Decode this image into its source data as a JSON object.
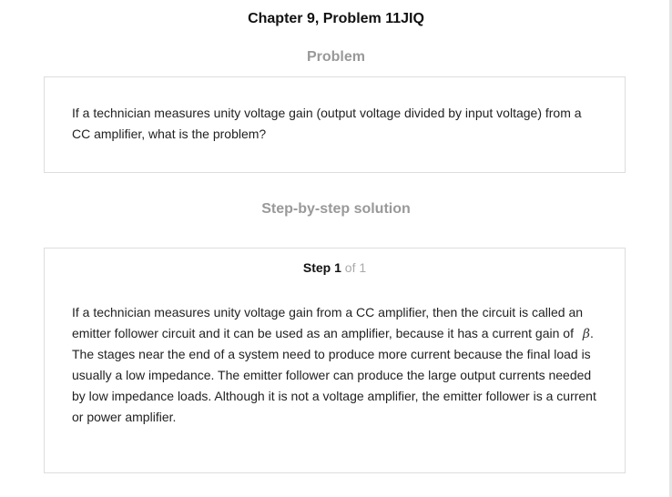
{
  "chapter_title": "Chapter 9, Problem 11JIQ",
  "problem": {
    "heading": "Problem",
    "text": "If a technician measures unity voltage gain (output voltage divided by input voltage) from a CC amplifier, what is the problem?"
  },
  "solution": {
    "heading": "Step-by-step solution",
    "step": {
      "word": "Step",
      "number": "1",
      "of_text": "of 1"
    },
    "text_before_symbol": "If a technician measures unity voltage gain from a CC amplifier, then the circuit is called an emitter follower circuit and it can be used as an amplifier, because it has a current gain of",
    "symbol": "β",
    "text_after_symbol": ". The stages near the end of a system need to produce more current because the final load is usually a low impedance. The emitter follower can produce the large output currents needed by low impedance loads. Although it is not a voltage amplifier, the emitter follower is a current or power amplifier."
  }
}
